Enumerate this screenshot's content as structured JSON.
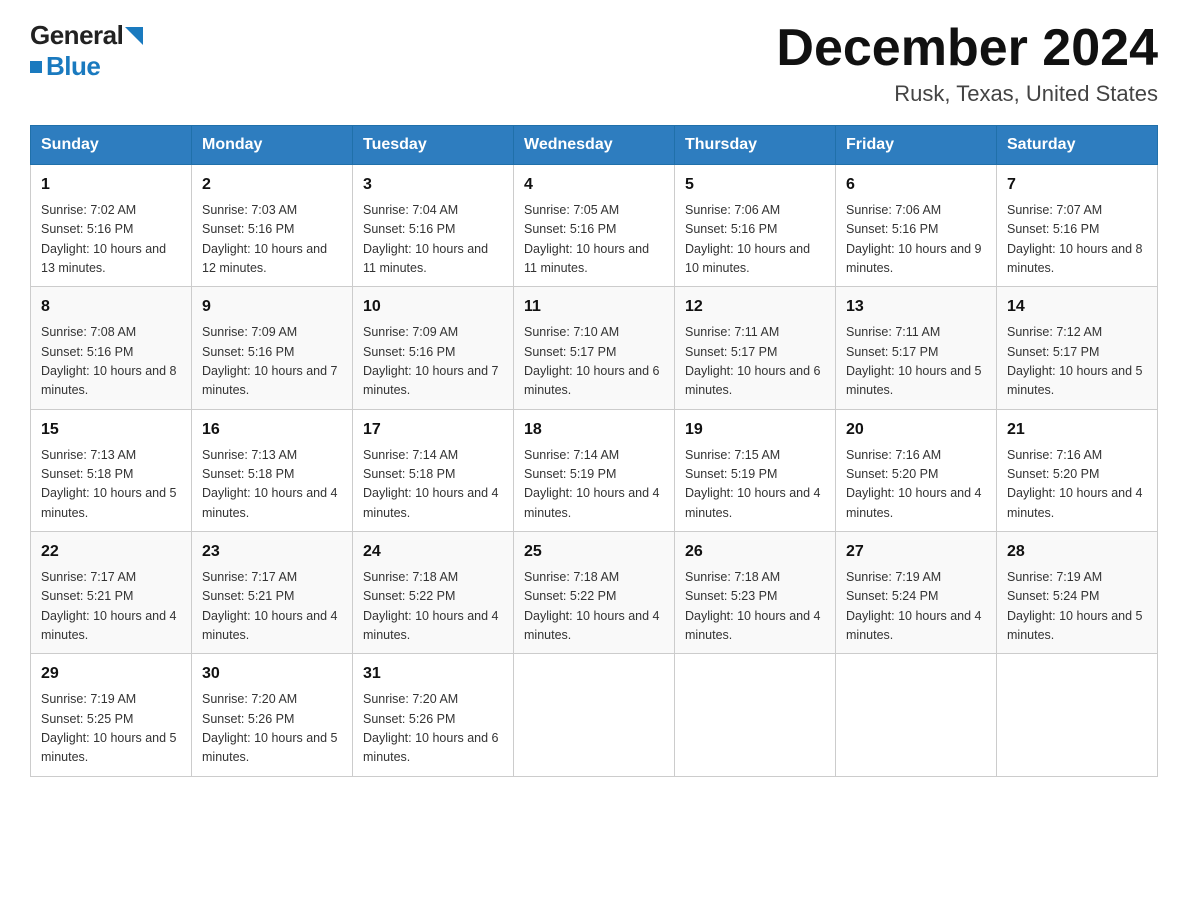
{
  "header": {
    "logo_general": "General",
    "logo_blue": "Blue",
    "month_title": "December 2024",
    "location": "Rusk, Texas, United States"
  },
  "weekdays": [
    "Sunday",
    "Monday",
    "Tuesday",
    "Wednesday",
    "Thursday",
    "Friday",
    "Saturday"
  ],
  "weeks": [
    [
      {
        "day": "1",
        "sunrise": "7:02 AM",
        "sunset": "5:16 PM",
        "daylight": "10 hours and 13 minutes."
      },
      {
        "day": "2",
        "sunrise": "7:03 AM",
        "sunset": "5:16 PM",
        "daylight": "10 hours and 12 minutes."
      },
      {
        "day": "3",
        "sunrise": "7:04 AM",
        "sunset": "5:16 PM",
        "daylight": "10 hours and 11 minutes."
      },
      {
        "day": "4",
        "sunrise": "7:05 AM",
        "sunset": "5:16 PM",
        "daylight": "10 hours and 11 minutes."
      },
      {
        "day": "5",
        "sunrise": "7:06 AM",
        "sunset": "5:16 PM",
        "daylight": "10 hours and 10 minutes."
      },
      {
        "day": "6",
        "sunrise": "7:06 AM",
        "sunset": "5:16 PM",
        "daylight": "10 hours and 9 minutes."
      },
      {
        "day": "7",
        "sunrise": "7:07 AM",
        "sunset": "5:16 PM",
        "daylight": "10 hours and 8 minutes."
      }
    ],
    [
      {
        "day": "8",
        "sunrise": "7:08 AM",
        "sunset": "5:16 PM",
        "daylight": "10 hours and 8 minutes."
      },
      {
        "day": "9",
        "sunrise": "7:09 AM",
        "sunset": "5:16 PM",
        "daylight": "10 hours and 7 minutes."
      },
      {
        "day": "10",
        "sunrise": "7:09 AM",
        "sunset": "5:16 PM",
        "daylight": "10 hours and 7 minutes."
      },
      {
        "day": "11",
        "sunrise": "7:10 AM",
        "sunset": "5:17 PM",
        "daylight": "10 hours and 6 minutes."
      },
      {
        "day": "12",
        "sunrise": "7:11 AM",
        "sunset": "5:17 PM",
        "daylight": "10 hours and 6 minutes."
      },
      {
        "day": "13",
        "sunrise": "7:11 AM",
        "sunset": "5:17 PM",
        "daylight": "10 hours and 5 minutes."
      },
      {
        "day": "14",
        "sunrise": "7:12 AM",
        "sunset": "5:17 PM",
        "daylight": "10 hours and 5 minutes."
      }
    ],
    [
      {
        "day": "15",
        "sunrise": "7:13 AM",
        "sunset": "5:18 PM",
        "daylight": "10 hours and 5 minutes."
      },
      {
        "day": "16",
        "sunrise": "7:13 AM",
        "sunset": "5:18 PM",
        "daylight": "10 hours and 4 minutes."
      },
      {
        "day": "17",
        "sunrise": "7:14 AM",
        "sunset": "5:18 PM",
        "daylight": "10 hours and 4 minutes."
      },
      {
        "day": "18",
        "sunrise": "7:14 AM",
        "sunset": "5:19 PM",
        "daylight": "10 hours and 4 minutes."
      },
      {
        "day": "19",
        "sunrise": "7:15 AM",
        "sunset": "5:19 PM",
        "daylight": "10 hours and 4 minutes."
      },
      {
        "day": "20",
        "sunrise": "7:16 AM",
        "sunset": "5:20 PM",
        "daylight": "10 hours and 4 minutes."
      },
      {
        "day": "21",
        "sunrise": "7:16 AM",
        "sunset": "5:20 PM",
        "daylight": "10 hours and 4 minutes."
      }
    ],
    [
      {
        "day": "22",
        "sunrise": "7:17 AM",
        "sunset": "5:21 PM",
        "daylight": "10 hours and 4 minutes."
      },
      {
        "day": "23",
        "sunrise": "7:17 AM",
        "sunset": "5:21 PM",
        "daylight": "10 hours and 4 minutes."
      },
      {
        "day": "24",
        "sunrise": "7:18 AM",
        "sunset": "5:22 PM",
        "daylight": "10 hours and 4 minutes."
      },
      {
        "day": "25",
        "sunrise": "7:18 AM",
        "sunset": "5:22 PM",
        "daylight": "10 hours and 4 minutes."
      },
      {
        "day": "26",
        "sunrise": "7:18 AM",
        "sunset": "5:23 PM",
        "daylight": "10 hours and 4 minutes."
      },
      {
        "day": "27",
        "sunrise": "7:19 AM",
        "sunset": "5:24 PM",
        "daylight": "10 hours and 4 minutes."
      },
      {
        "day": "28",
        "sunrise": "7:19 AM",
        "sunset": "5:24 PM",
        "daylight": "10 hours and 5 minutes."
      }
    ],
    [
      {
        "day": "29",
        "sunrise": "7:19 AM",
        "sunset": "5:25 PM",
        "daylight": "10 hours and 5 minutes."
      },
      {
        "day": "30",
        "sunrise": "7:20 AM",
        "sunset": "5:26 PM",
        "daylight": "10 hours and 5 minutes."
      },
      {
        "day": "31",
        "sunrise": "7:20 AM",
        "sunset": "5:26 PM",
        "daylight": "10 hours and 6 minutes."
      },
      null,
      null,
      null,
      null
    ]
  ]
}
